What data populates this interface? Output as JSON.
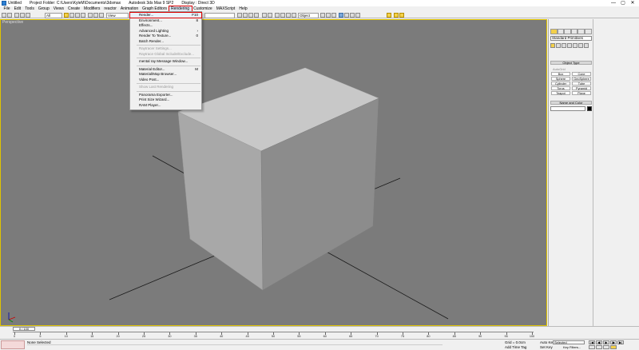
{
  "titlebar": {
    "doc": "Untitled",
    "project": "Project Folder: C:\\Users\\KyleM\\Documents\\3dsmax",
    "app": "Autodesk 3ds Max  9 SP2",
    "display": "Display : Direct 3D",
    "min": "—",
    "max": "▢",
    "close": "✕"
  },
  "menubar": {
    "items": [
      "File",
      "Edit",
      "Tools",
      "Group",
      "Views",
      "Create",
      "Modifiers",
      "reactor",
      "Animation",
      "Graph Editors",
      "Rendering",
      "Customize",
      "MAXScript",
      "Help"
    ],
    "active_index": 10
  },
  "toolbar": {
    "filter": "All",
    "refcoord": "View",
    "named_sel": "",
    "pivot": "Object"
  },
  "viewport": {
    "label": "Perspective"
  },
  "rendering_menu": {
    "items": [
      {
        "label": "Render...",
        "shortcut": "F10",
        "highlighted": true,
        "disabled": false
      },
      {
        "label": "Environment...",
        "shortcut": "8",
        "highlighted": false,
        "disabled": false
      },
      {
        "label": "Effects...",
        "shortcut": "",
        "highlighted": false,
        "disabled": false
      },
      {
        "label": "Advanced Lighting",
        "shortcut": "›",
        "highlighted": false,
        "disabled": false
      },
      {
        "label": "Render To Texture...",
        "shortcut": "0",
        "highlighted": false,
        "disabled": false
      },
      {
        "label": "Batch Render...",
        "shortcut": "",
        "highlighted": false,
        "disabled": false
      },
      {
        "label": "Raytracer Settings...",
        "shortcut": "",
        "highlighted": false,
        "disabled": true
      },
      {
        "label": "Raytrace Global Include/Exclude...",
        "shortcut": "",
        "highlighted": false,
        "disabled": true
      },
      {
        "label": "mental ray Message Window...",
        "shortcut": "",
        "highlighted": false,
        "disabled": false
      },
      {
        "label": "Material Editor...",
        "shortcut": "M",
        "highlighted": false,
        "disabled": false
      },
      {
        "label": "Material/Map Browser...",
        "shortcut": "",
        "highlighted": false,
        "disabled": false
      },
      {
        "label": "Video Post...",
        "shortcut": "",
        "highlighted": false,
        "disabled": false
      },
      {
        "label": "Show Last Rendering",
        "shortcut": "",
        "highlighted": false,
        "disabled": true
      },
      {
        "label": "Panorama Exporter...",
        "shortcut": "",
        "highlighted": false,
        "disabled": false
      },
      {
        "label": "Print Size Wizard...",
        "shortcut": "",
        "highlighted": false,
        "disabled": false
      },
      {
        "label": "RAM Player...",
        "shortcut": "",
        "highlighted": false,
        "disabled": false
      }
    ]
  },
  "command_panel": {
    "dropdown": "Standard Primitives",
    "object_type_title": "Object Type",
    "autogrid": "AutoGrid",
    "buttons": [
      "Box",
      "Cone",
      "Sphere",
      "GeoSphere",
      "Cylinder",
      "Tube",
      "Torus",
      "Pyramid",
      "Teapot",
      "Plane"
    ],
    "name_color_title": "Name and Color",
    "object_color": "#000000"
  },
  "timeline": {
    "frame_counter": "0 / 100",
    "ticks": [
      "0",
      "5",
      "10",
      "15",
      "20",
      "25",
      "30",
      "35",
      "40",
      "45",
      "50",
      "55",
      "60",
      "65",
      "70",
      "75",
      "80",
      "85",
      "90",
      "95",
      "100"
    ]
  },
  "statusbar": {
    "status": "None Selected",
    "grid": "Grid = 0.0cm",
    "add_time_tag": "Add Time Tag",
    "auto_key": "Auto Key",
    "set_key": "Set Key",
    "selected": "Selected",
    "key_filters": "Key Filters...",
    "playback": [
      "|◀",
      "◀|",
      "▶",
      "|▶",
      "▶|"
    ]
  },
  "colors": {
    "viewport_bg": "#7b7b7b",
    "viewport_border": "#e0c400",
    "highlight_red": "#dd0000",
    "cube_top": "#c8c8c8",
    "cube_left": "#a8a8a8",
    "cube_right": "#8c8c8c"
  }
}
